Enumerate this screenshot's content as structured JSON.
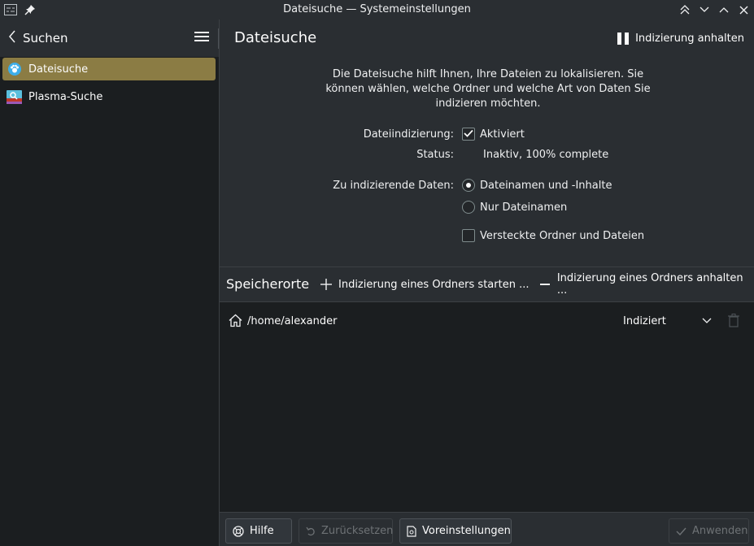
{
  "window": {
    "title": "Dateisuche — Systemeinstellungen"
  },
  "sidebar": {
    "back_label": "Suchen",
    "items": [
      {
        "label": "Dateisuche",
        "active": true,
        "icon": "baloo-icon"
      },
      {
        "label": "Plasma-Suche",
        "active": false,
        "icon": "krunner-icon"
      }
    ]
  },
  "header": {
    "title": "Dateisuche",
    "pause_label": "Indizierung anhalten"
  },
  "settings": {
    "description": "Die Dateisuche hilft Ihnen, Ihre Dateien zu lokalisieren. Sie können wählen, welche Ordner und welche Art von Daten Sie indizieren möchten.",
    "indexing_label": "Dateiindizierung:",
    "indexing_value": "Aktiviert",
    "indexing_checked": true,
    "status_label": "Status:",
    "status_value": "Inaktiv, 100% complete",
    "data_label": "Zu indizierende Daten:",
    "option_contents": "Dateinamen und -Inhalte",
    "option_names": "Nur Dateinamen",
    "selected_option": "contents",
    "hidden_label": "Versteckte Ordner und Dateien",
    "hidden_checked": false
  },
  "locations": {
    "title": "Speicherorte",
    "start_label": "Indizierung eines Ordners starten ...",
    "stop_label": "Indizierung eines Ordners anhalten ...",
    "rows": [
      {
        "path": "/home/alexander",
        "status": "Indiziert"
      }
    ]
  },
  "footer": {
    "help_label": "Hilfe",
    "reset_label": "Zurücksetzen",
    "defaults_label": "Voreinstellungen",
    "apply_label": "Anwenden"
  },
  "colors": {
    "accent": "#8b7c44",
    "window_bg": "#2a2e32",
    "view_bg": "#1b1e20",
    "text": "#fcfcfc",
    "disabled_text": "#6e7275"
  }
}
